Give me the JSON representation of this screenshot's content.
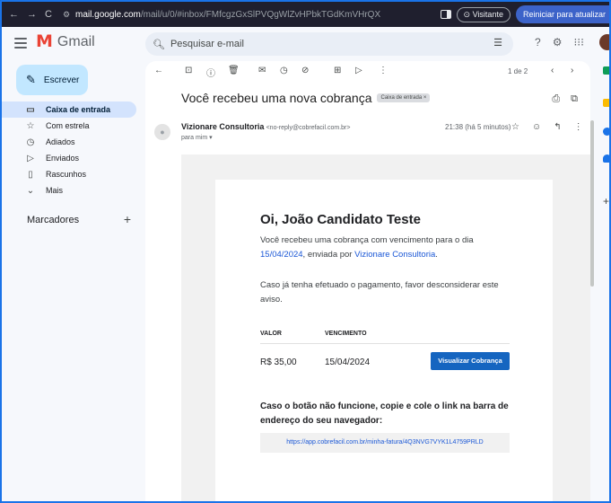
{
  "browser": {
    "url_host": "mail.google.com",
    "url_path": "/mail/u/0/#inbox/FMfcgzGxSlPVQgWlZvHPbkTGdKmVHrQX",
    "visitor_label": "Visitante",
    "restart_label": "Reiniciar para atualizar"
  },
  "gmail": {
    "logo_text": "Gmail",
    "search_placeholder": "Pesquisar e-mail"
  },
  "sidebar": {
    "compose_label": "Escrever",
    "items": [
      {
        "label": "Caixa de entrada",
        "icon": "inbox-icon",
        "active": true
      },
      {
        "label": "Com estrela",
        "icon": "star-icon"
      },
      {
        "label": "Adiados",
        "icon": "clock-icon"
      },
      {
        "label": "Enviados",
        "icon": "send-icon"
      },
      {
        "label": "Rascunhos",
        "icon": "draft-icon"
      },
      {
        "label": "Mais",
        "icon": "chevron-down-icon"
      }
    ],
    "labels_title": "Marcadores"
  },
  "toolbar": {
    "pager": "1 de 2"
  },
  "message": {
    "subject": "Você recebeu uma nova cobrança",
    "label_chip": "Caixa de entrada ×",
    "sender_name": "Vizionare Consultoria",
    "sender_email": "<no-reply@cobrefacil.com.br>",
    "recipient": "para mim ▾",
    "time": "21:38 (há 5 minutos)"
  },
  "email": {
    "greeting": "Oi, João Candidato Teste",
    "p1_text": "Você recebeu uma cobrança com vencimento para o dia",
    "p1_date": "15/04/2024",
    "p1_mid": ", enviada por ",
    "p1_company": "Vizionare Consultoria",
    "p1_end": ".",
    "p2": "Caso já tenha efetuado o pagamento, favor desconsiderar este aviso.",
    "col_value": "VALOR",
    "col_due": "VENCIMENTO",
    "amount": "R$ 35,00",
    "due_date": "15/04/2024",
    "button_label": "Visualizar Cobrança",
    "fallback_text": "Caso o botão não funcione, copie e cole o link na barra de endereço do seu navegador:",
    "link": "https://app.cobrefacil.com.br/minha-fatura/4Q3NVG7VYK1L4759PRLD"
  },
  "colors": {
    "accent": "#1a73e8",
    "compose_bg": "#c2e7ff",
    "active_item_bg": "#d3e3fd",
    "button_bg": "#1565c0"
  }
}
